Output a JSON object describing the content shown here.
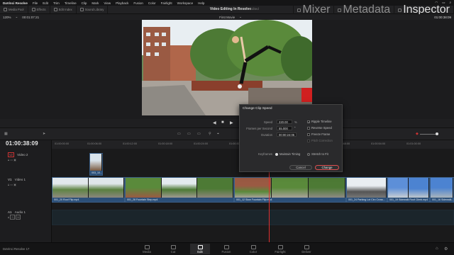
{
  "menubar": {
    "app": "DaVinci Resolve",
    "items": [
      "File",
      "Edit",
      "Trim",
      "Timeline",
      "Clip",
      "Mark",
      "View",
      "Playback",
      "Fusion",
      "Color",
      "Fairlight",
      "Workspace",
      "Help"
    ]
  },
  "toolbar": {
    "media_pool": "Media Pool",
    "effects": "Effects",
    "edit_index": "Edit Index",
    "sound_library": "Sound Library",
    "project_title": "Video Editing In Resolve",
    "project_status": "Edited",
    "mixer": "Mixer",
    "metadata": "Metadata",
    "inspector": "Inspector"
  },
  "viewer": {
    "zoom": "120%",
    "source_tc": "00:01:07:21",
    "timeline_name": "First Movie",
    "record_tc": "01:00:38:09"
  },
  "timeline": {
    "timecode": "01:00:38:09",
    "ruler": [
      "01:00:00:00",
      "01:00:06:00",
      "01:00:12:00",
      "01:00:18:00",
      "01:00:24:00",
      "01:00:30:00",
      "01:00:36:00",
      "01:00:42:00",
      "01:00:48:00",
      "01:00:54:00",
      "01:01:00:00"
    ],
    "tracks": {
      "v2": {
        "id": "V2",
        "name": "Video 2"
      },
      "v1": {
        "id": "V1",
        "name": "Video 1"
      },
      "a1": {
        "id": "A1",
        "name": "Audio 1"
      }
    },
    "clips_v2": [
      {
        "name": "003_10..."
      }
    ],
    "clips_v1": [
      {
        "name": "001_20 Roof Flip.mp4"
      },
      {
        "name": "001_28 Fountain Step.mp4"
      },
      {
        "name": "001_12 Slow Fountain Flip.mp4"
      },
      {
        "name": "001_24 Parking Lot Circ Cross..."
      },
      {
        "name": "001_19 Sidewalk Roof Climb.mp4"
      },
      {
        "name": "001_16 Sidewalk..."
      }
    ]
  },
  "dialog": {
    "title": "Change Clip Speed",
    "speed_label": "Speed",
    "speed_value": "220.00",
    "speed_unit": "%",
    "fps_label": "Frames per Second",
    "fps_value": "55.000",
    "duration_label": "Duration",
    "duration_value": "00:00:24:05",
    "ripple_label": "Ripple Timeline",
    "reverse_label": "Reverse Speed",
    "freeze_label": "Freeze Frame",
    "pitch_label": "Pitch Correction",
    "keyframes_label": "Keyframes",
    "maintain_label": "Maintain Timing",
    "stretch_label": "Stretch to Fit",
    "cancel": "Cancel",
    "change": "Change"
  },
  "pages": {
    "items": [
      "Media",
      "Cut",
      "Edit",
      "Fusion",
      "Color",
      "Fairlight",
      "Deliver"
    ],
    "active": "Edit"
  },
  "bottom": {
    "app_name": "DaVinci Resolve 17"
  },
  "colors": {
    "accent": "#e03030",
    "clip_blue": "#2b4f78",
    "active_page": "#ffffff"
  }
}
